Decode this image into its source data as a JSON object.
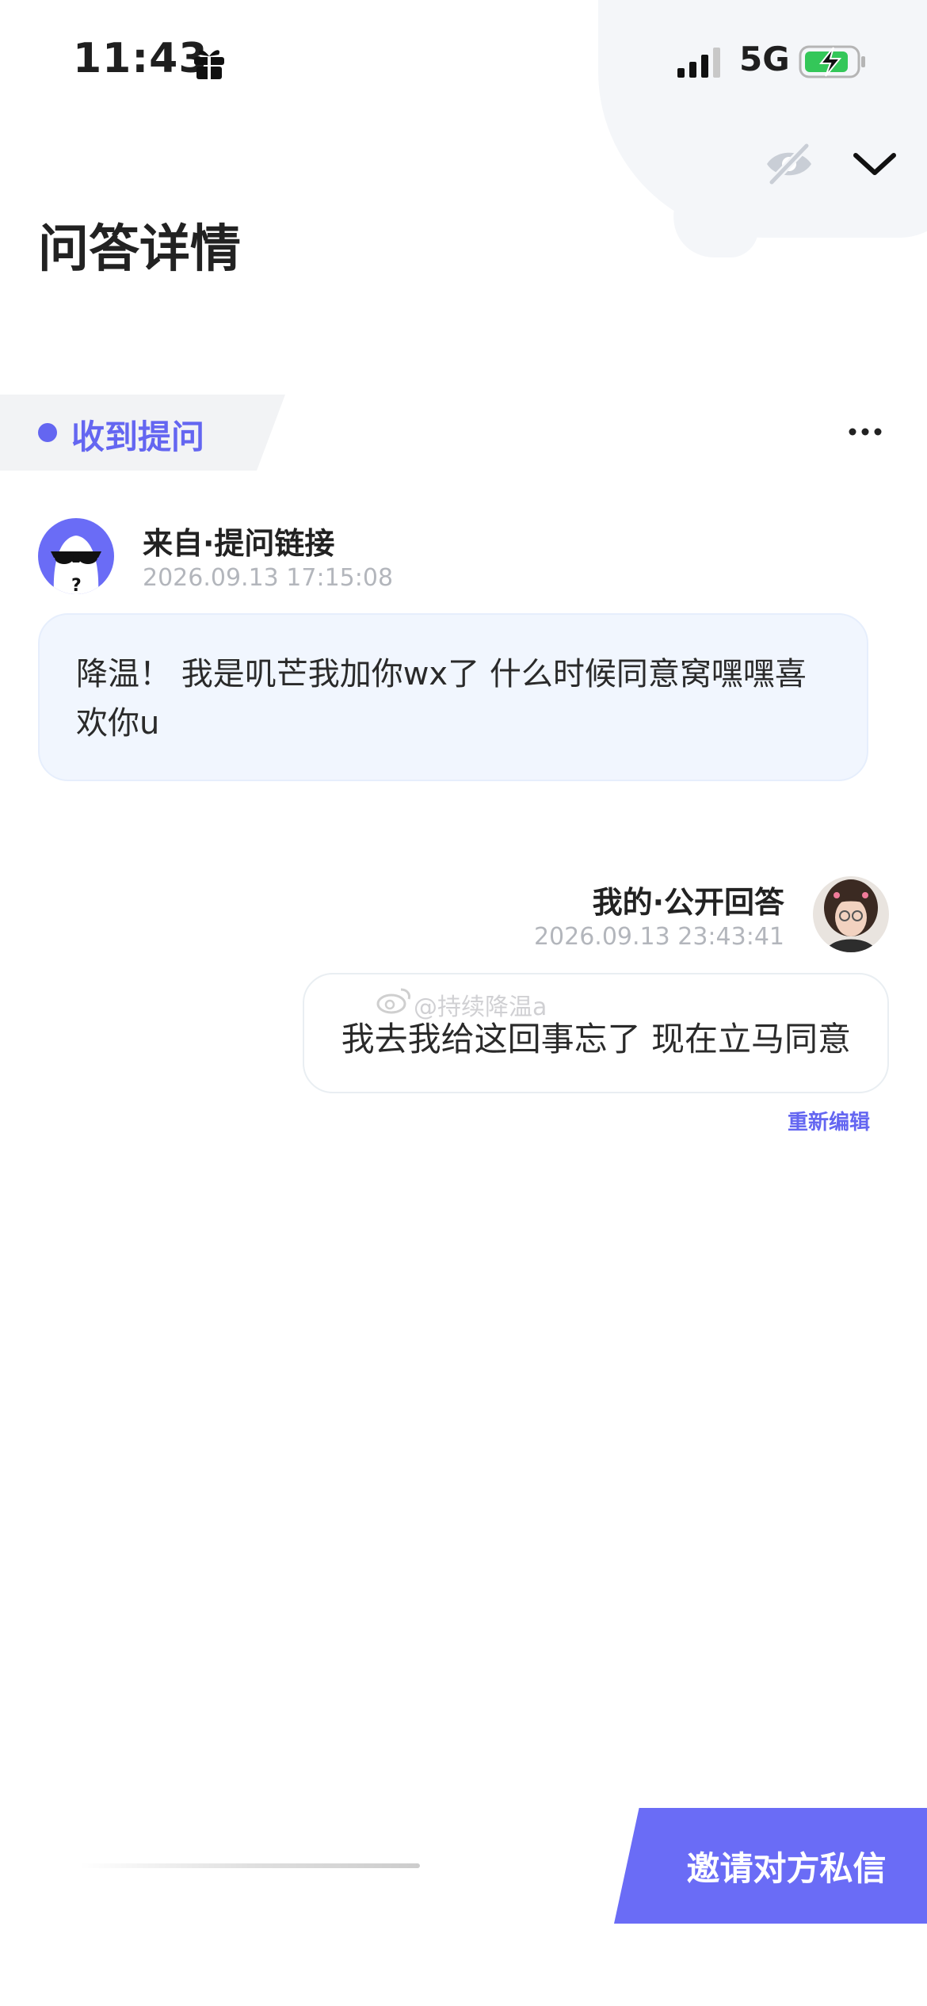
{
  "status_bar": {
    "time": "11:43",
    "network": "5G"
  },
  "header": {
    "title": "问答详情"
  },
  "tag": {
    "label": "收到提问"
  },
  "question": {
    "from": "来自·提问链接",
    "time": "2026.09.13 17:15:08",
    "text": "降温！ 我是叽芒我加你wx了 什么时候同意窝嘿嘿喜欢你u"
  },
  "answer": {
    "from": "我的·公开回答",
    "time": "2026.09.13 23:43:41",
    "text": "我去我给这回事忘了 现在立马同意",
    "reedit_label": "重新编辑"
  },
  "watermark": {
    "text": "@持续降温a"
  },
  "footer": {
    "invite_label": "邀请对方私信"
  },
  "colors": {
    "accent": "#6466f1",
    "question_bg": "#f1f6fe",
    "battery_green": "#34c759"
  }
}
